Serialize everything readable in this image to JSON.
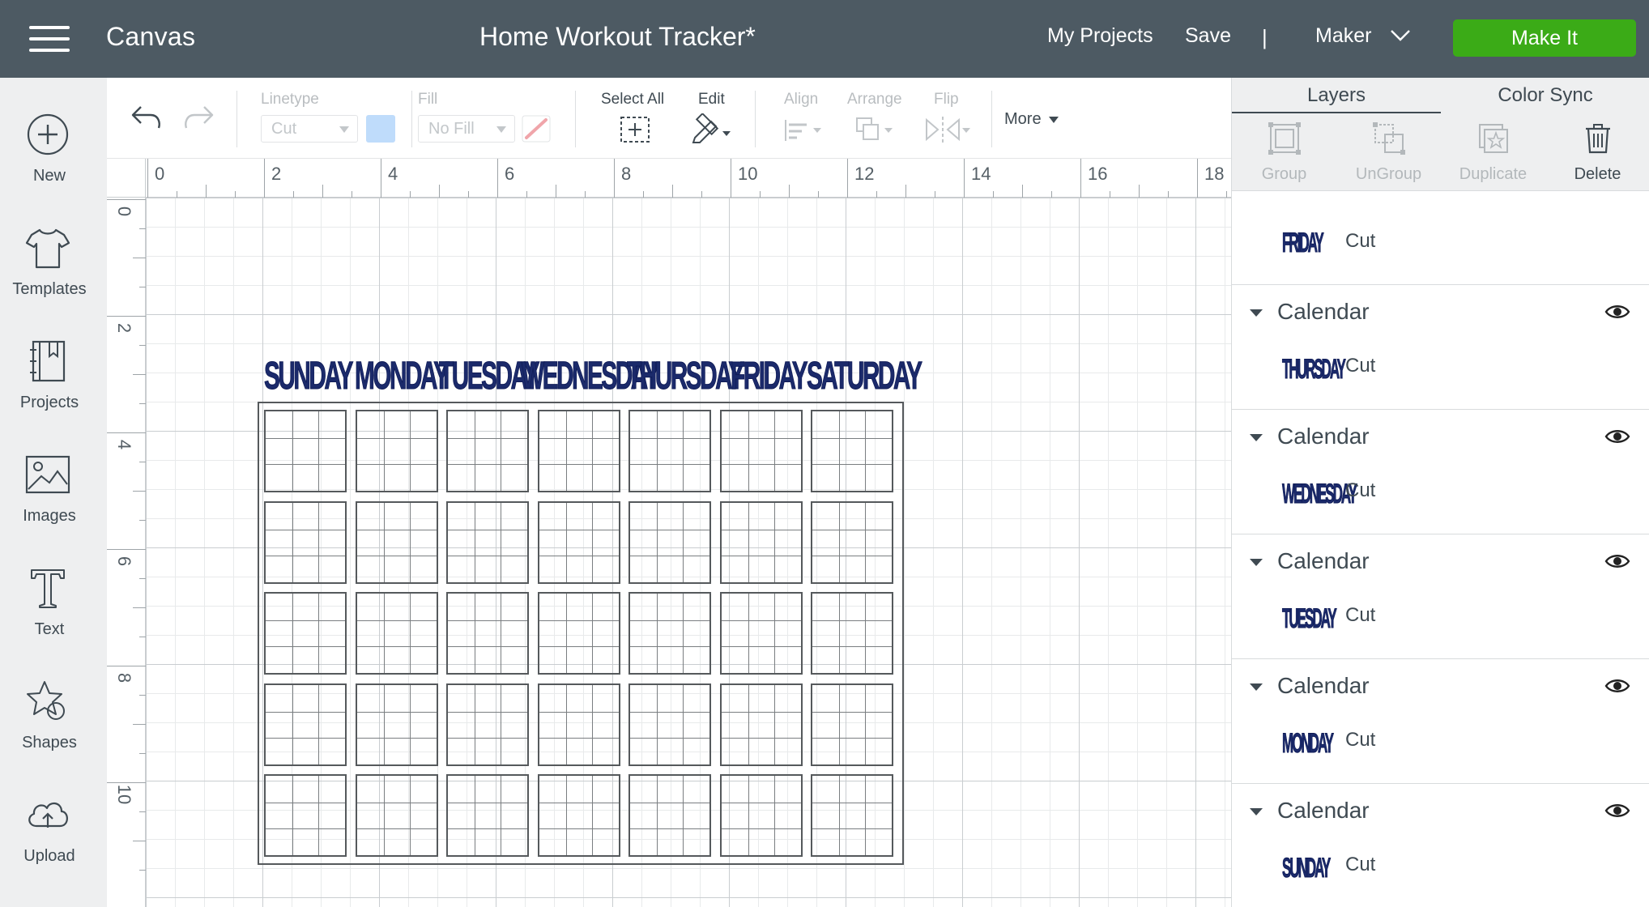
{
  "header": {
    "app_name": "Canvas",
    "project_title": "Home Workout Tracker*",
    "my_projects": "My Projects",
    "save": "Save",
    "divider": "|",
    "machine": "Maker",
    "make_it": "Make It",
    "bg_color": "#4d5a63",
    "make_it_color": "#3bab17"
  },
  "sidebar": {
    "items": [
      {
        "label": "New",
        "icon": "plus-circle-icon"
      },
      {
        "label": "Templates",
        "icon": "tshirt-icon"
      },
      {
        "label": "Projects",
        "icon": "notebook-icon"
      },
      {
        "label": "Images",
        "icon": "image-icon"
      },
      {
        "label": "Text",
        "icon": "text-T-icon"
      },
      {
        "label": "Shapes",
        "icon": "shapes-icon"
      },
      {
        "label": "Upload",
        "icon": "cloud-upload-icon"
      }
    ]
  },
  "toolbar": {
    "linetype_label": "Linetype",
    "linetype_value": "Cut",
    "fill_label": "Fill",
    "fill_value": "No Fill",
    "select_all": "Select All",
    "edit": "Edit",
    "align": "Align",
    "arrange": "Arrange",
    "flip": "Flip",
    "more": "More",
    "swatch_color": "#bfdcfb"
  },
  "canvas": {
    "ruler_top": [
      "0",
      "2",
      "4",
      "6",
      "8",
      "10",
      "12",
      "14",
      "16",
      "18"
    ],
    "ruler_left": [
      "0",
      "2",
      "4",
      "6",
      "8",
      "10"
    ],
    "day_titles": [
      "SUNDAY",
      "MONDAY",
      "TUESDAY",
      "WEDNESDAY",
      "THURSDAY",
      "FRIDAY",
      "SATURDAY"
    ],
    "calendar_rows": 5,
    "calendar_cols": 7,
    "title_color": "#1b2a6b"
  },
  "right_panel": {
    "tabs": [
      "Layers",
      "Color Sync"
    ],
    "actions": [
      {
        "label": "Group",
        "icon": "group-icon",
        "enabled": false
      },
      {
        "label": "UnGroup",
        "icon": "ungroup-icon",
        "enabled": false
      },
      {
        "label": "Duplicate",
        "icon": "duplicate-icon",
        "enabled": false
      },
      {
        "label": "Delete",
        "icon": "trash-icon",
        "enabled": true
      }
    ],
    "single_layer": {
      "thumb": "FRIDAY",
      "op": "Cut"
    },
    "groups": [
      {
        "name": "Calendar",
        "thumb": "THURSDAY",
        "op": "Cut"
      },
      {
        "name": "Calendar",
        "thumb": "WEDNESDAY",
        "op": "Cut"
      },
      {
        "name": "Calendar",
        "thumb": "TUESDAY",
        "op": "Cut"
      },
      {
        "name": "Calendar",
        "thumb": "MONDAY",
        "op": "Cut"
      },
      {
        "name": "Calendar",
        "thumb": "SUNDAY",
        "op": "Cut"
      }
    ]
  }
}
